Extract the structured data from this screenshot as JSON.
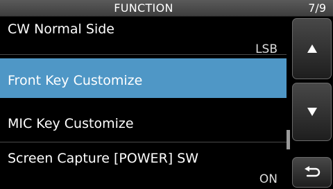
{
  "header": {
    "title": "FUNCTION",
    "page": "7/9"
  },
  "menu": {
    "items": [
      {
        "label": "CW Normal Side",
        "value": "LSB"
      },
      {
        "label": "Front Key Customize",
        "value": ""
      },
      {
        "label": "MIC Key Customize",
        "value": ""
      },
      {
        "label": "Screen Capture [POWER] SW",
        "value": "ON"
      }
    ]
  },
  "colors": {
    "selected_row": "#4f97c6",
    "background": "#000000",
    "title_bar": "#4a4a4a"
  },
  "icons": {
    "up": "triangle-up-icon",
    "down": "triangle-down-icon",
    "back": "return-arrow-icon"
  }
}
